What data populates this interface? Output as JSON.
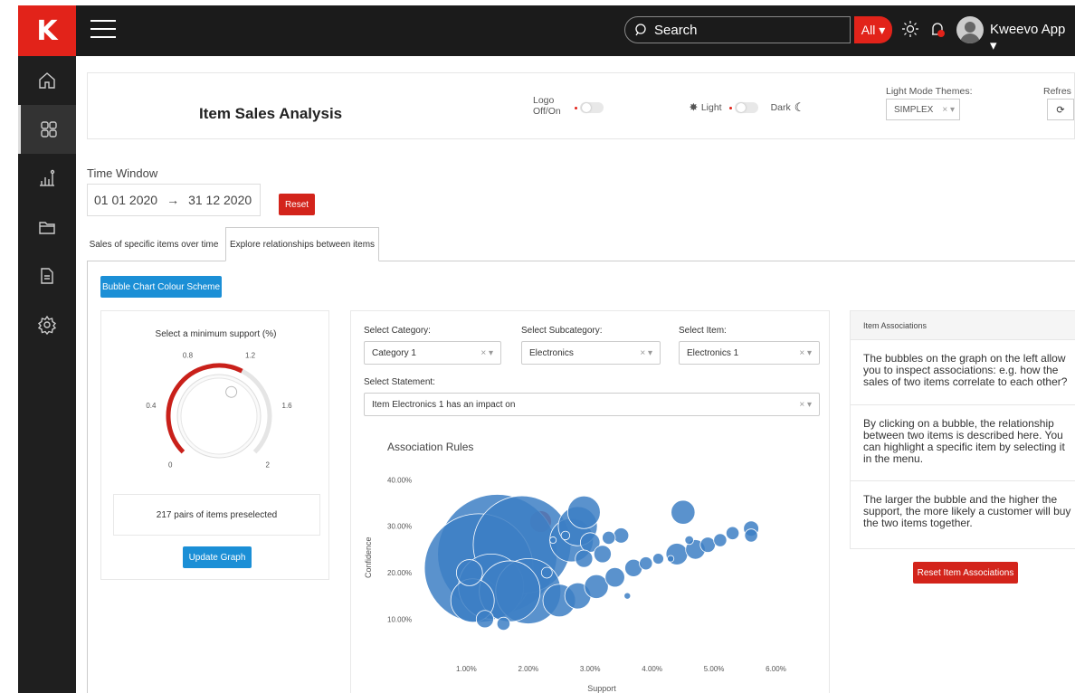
{
  "sidebar": {
    "logo": "K",
    "items": [
      {
        "name": "home-icon"
      },
      {
        "name": "dashboard-grid-icon"
      },
      {
        "name": "analytics-icon"
      },
      {
        "name": "folder-icon"
      },
      {
        "name": "document-icon"
      },
      {
        "name": "settings-gear-icon"
      }
    ]
  },
  "topbar": {
    "search_placeholder": "Search",
    "search_scope": "All ▾",
    "user_name": "Kweevo App ▾"
  },
  "header": {
    "title": "Item Sales Analysis",
    "logo_toggle_label_line1": "Logo",
    "logo_toggle_label_line2": "Off/On",
    "light_label": "Light",
    "dark_label": "Dark",
    "themes_label": "Light Mode Themes:",
    "theme_value": "SIMPLEX",
    "refresh_label": "Refres"
  },
  "time_window": {
    "label": "Time Window",
    "start": "01 01 2020",
    "arrow": "→",
    "end": "31 12 2020",
    "reset": "Reset"
  },
  "tabs": [
    {
      "label": "Sales of specific items over time"
    },
    {
      "label": "Explore relationships between items"
    }
  ],
  "main": {
    "colour_scheme_button": "Bubble Chart Colour Scheme",
    "knob": {
      "title": "Select a minimum support (%)",
      "ticks": [
        "0",
        "0.4",
        "0.8",
        "1.2",
        "1.6",
        "2"
      ],
      "value": 1.2,
      "min": 0,
      "max": 2
    },
    "pairs_text": "217 pairs of items preselected",
    "update_button": "Update Graph",
    "filters": {
      "category_label": "Select Category:",
      "category_value": "Category 1",
      "subcategory_label": "Select Subcategory:",
      "subcategory_value": "Electronics",
      "item_label": "Select Item:",
      "item_value": "Electronics 1",
      "statement_label": "Select Statement:",
      "statement_value": "Item Electronics 1 has an impact on"
    },
    "associations": {
      "header": "Item Associations",
      "p1": "The bubbles on the graph on the left allow you to inspect associations: e.g. how the sales of two items correlate to each other?",
      "p2": "By clicking on a bubble, the relationship between two items is described here. You can highlight a specific item by selecting it in the menu.",
      "p3": "The larger the bubble and the higher the support, the more likely a customer will buy the two items together.",
      "reset_button": "Reset Item Associations"
    }
  },
  "chart_data": {
    "type": "scatter",
    "title": "Association Rules",
    "xlabel": "Support",
    "ylabel": "Confidence",
    "xlim": [
      0.6,
      6.3
    ],
    "ylim": [
      5,
      42
    ],
    "x_ticks": [
      "1.00%",
      "2.00%",
      "3.00%",
      "4.00%",
      "5.00%",
      "6.00%"
    ],
    "y_ticks": [
      "10.00%",
      "20.00%",
      "30.00%",
      "40.00%"
    ],
    "colors": {
      "bubble": "#3d7fc4",
      "highlight": "#e04040"
    },
    "points": [
      {
        "x": 1.2,
        "y": 21,
        "r": 5.0
      },
      {
        "x": 1.5,
        "y": 24,
        "r": 5.5
      },
      {
        "x": 1.9,
        "y": 26,
        "r": 4.5
      },
      {
        "x": 1.4,
        "y": 17,
        "r": 3.0
      },
      {
        "x": 1.7,
        "y": 16,
        "r": 2.8
      },
      {
        "x": 2.0,
        "y": 16,
        "r": 3.0
      },
      {
        "x": 1.1,
        "y": 14,
        "r": 2.0
      },
      {
        "x": 2.7,
        "y": 27,
        "r": 2.0
      },
      {
        "x": 2.8,
        "y": 30,
        "r": 1.8
      },
      {
        "x": 2.9,
        "y": 33,
        "r": 1.5
      },
      {
        "x": 1.05,
        "y": 20,
        "r": 1.2
      },
      {
        "x": 1.3,
        "y": 10,
        "r": 0.8
      },
      {
        "x": 1.6,
        "y": 9,
        "r": 0.6
      },
      {
        "x": 2.5,
        "y": 14,
        "r": 1.5
      },
      {
        "x": 2.8,
        "y": 15,
        "r": 1.2
      },
      {
        "x": 3.1,
        "y": 17,
        "r": 1.1
      },
      {
        "x": 3.4,
        "y": 19,
        "r": 0.9
      },
      {
        "x": 3.7,
        "y": 21,
        "r": 0.8
      },
      {
        "x": 3.9,
        "y": 22,
        "r": 0.6
      },
      {
        "x": 4.1,
        "y": 23,
        "r": 0.5
      },
      {
        "x": 2.9,
        "y": 23,
        "r": 0.8
      },
      {
        "x": 3.2,
        "y": 24,
        "r": 0.8
      },
      {
        "x": 3.0,
        "y": 26.5,
        "r": 0.9
      },
      {
        "x": 3.5,
        "y": 28,
        "r": 0.7
      },
      {
        "x": 3.3,
        "y": 27.5,
        "r": 0.6
      },
      {
        "x": 2.6,
        "y": 28,
        "r": 0.4
      },
      {
        "x": 2.3,
        "y": 20,
        "r": 0.5
      },
      {
        "x": 2.2,
        "y": 31,
        "r": 1.0,
        "highlight": true
      },
      {
        "x": 4.4,
        "y": 24,
        "r": 1.0
      },
      {
        "x": 4.7,
        "y": 25,
        "r": 0.9
      },
      {
        "x": 4.9,
        "y": 26,
        "r": 0.7
      },
      {
        "x": 5.1,
        "y": 27,
        "r": 0.6
      },
      {
        "x": 5.3,
        "y": 28.5,
        "r": 0.6
      },
      {
        "x": 5.6,
        "y": 29.5,
        "r": 0.7
      },
      {
        "x": 5.6,
        "y": 28,
        "r": 0.6
      },
      {
        "x": 4.5,
        "y": 33,
        "r": 1.1
      },
      {
        "x": 4.6,
        "y": 27,
        "r": 0.4
      },
      {
        "x": 4.3,
        "y": 23,
        "r": 0.3
      },
      {
        "x": 3.6,
        "y": 15,
        "r": 0.3
      },
      {
        "x": 2.4,
        "y": 27,
        "r": 0.3
      }
    ]
  }
}
